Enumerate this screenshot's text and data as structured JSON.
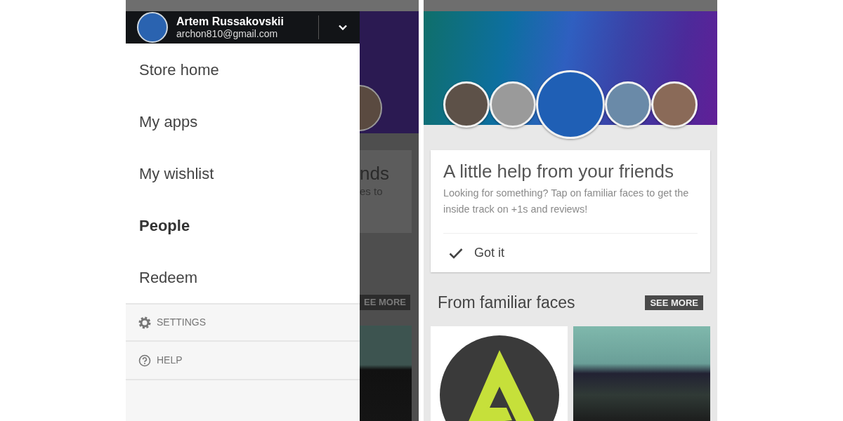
{
  "left_screen": {
    "drawer": {
      "account": {
        "name": "Artem Russakovskii",
        "email": "archon810@gmail.com"
      },
      "items": [
        {
          "label": "Store home",
          "selected": false
        },
        {
          "label": "My apps",
          "selected": false
        },
        {
          "label": "My wishlist",
          "selected": false
        },
        {
          "label": "People",
          "selected": true
        },
        {
          "label": "Redeem",
          "selected": false
        }
      ],
      "footer_items": [
        {
          "label": "SETTINGS",
          "kind": "settings"
        },
        {
          "label": "HELP",
          "kind": "help"
        }
      ]
    },
    "dimmed_background": {
      "title_fragment": "nds",
      "text_fragment": "es to",
      "see_more_fragment": "EE MORE"
    }
  },
  "right_screen": {
    "card": {
      "title": "A little help from your friends",
      "body": "Looking for something? Tap on familiar faces to get the inside track on +1s and reviews!",
      "action": "Got it"
    },
    "section": {
      "title": "From familiar faces",
      "see_more": "SEE MORE"
    }
  }
}
